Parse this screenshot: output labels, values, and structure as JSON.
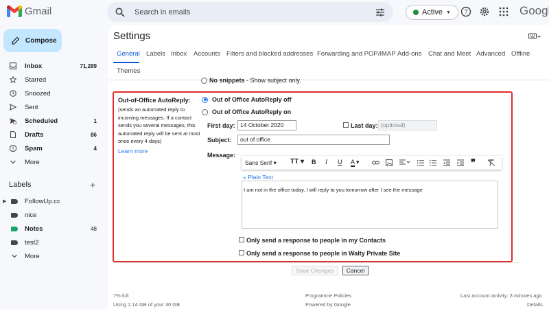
{
  "app": {
    "name": "Gmail"
  },
  "search": {
    "placeholder": "Search in emails"
  },
  "status": {
    "label": "Active",
    "color": "#1e8e3e"
  },
  "brand": {
    "partial": "Googl"
  },
  "compose": {
    "label": "Compose"
  },
  "nav": [
    {
      "label": "Inbox",
      "count": "71,289",
      "icon": "inbox-icon",
      "bold": true
    },
    {
      "label": "Starred",
      "count": "",
      "icon": "star-icon",
      "bold": false
    },
    {
      "label": "Snoozed",
      "count": "",
      "icon": "clock-icon",
      "bold": false
    },
    {
      "label": "Sent",
      "count": "",
      "icon": "send-icon",
      "bold": false
    },
    {
      "label": "Scheduled",
      "count": "1",
      "icon": "scheduled-icon",
      "bold": true
    },
    {
      "label": "Drafts",
      "count": "86",
      "icon": "draft-icon",
      "bold": true
    },
    {
      "label": "Spam",
      "count": "4",
      "icon": "spam-icon",
      "bold": true
    },
    {
      "label": "More",
      "count": "",
      "icon": "chevron-down-icon",
      "bold": false
    }
  ],
  "labels_section": {
    "title": "Labels"
  },
  "labels": [
    {
      "name": "FollowUp.cc",
      "count": "",
      "color": "#444746",
      "bold": false,
      "caret": true
    },
    {
      "name": "nice",
      "count": "",
      "color": "#444746",
      "bold": false,
      "caret": false
    },
    {
      "name": "Notes",
      "count": "48",
      "color": "#16a765",
      "bold": true,
      "caret": false
    },
    {
      "name": "test2",
      "count": "",
      "color": "#444746",
      "bold": false,
      "caret": false
    },
    {
      "name": "More",
      "count": "",
      "color": "",
      "bold": false,
      "caret": false
    }
  ],
  "settings": {
    "title": "Settings",
    "tabs": [
      "General",
      "Labels",
      "Inbox",
      "Accounts",
      "Filters and blocked addresses",
      "Forwarding and POP/IMAP",
      "Add-ons",
      "Chat and Meet",
      "Advanced",
      "Offline",
      "Themes"
    ],
    "active_tab": "General",
    "snippet_label": "No snippets",
    "snippet_desc": " - Show subject only."
  },
  "ooo": {
    "title": "Out-of-Office AutoReply:",
    "desc": "(sends an automated reply to incoming messages. If a contact sends you several messages, this automated reply will be sent at most once every 4 days)",
    "learn_more": "Learn more",
    "off_label": "Out of Office AutoReply off",
    "on_label": "Out of Office AutoReply on",
    "selected": "off",
    "first_day_label": "First day:",
    "first_day_value": "14 October 2020",
    "last_day_label": "Last day:",
    "last_day_placeholder": "(optional)",
    "last_day_checked": false,
    "subject_label": "Subject:",
    "subject_value": "out of office",
    "message_label": "Message:",
    "font_name": "Sans Serif",
    "plain_text_link": "« Plain Text",
    "message_body": "I am not in the office today, I will reply to you tomorrow after I see the message",
    "contacts_only_label": "Only send a response to people in my Contacts",
    "contacts_only_checked": false,
    "org_only_label": "Only send a response to people in Walty Private Site",
    "org_only_checked": false
  },
  "actions": {
    "save": "Save Changes",
    "cancel": "Cancel"
  },
  "footer": {
    "storage_percent": "7% full",
    "storage_detail": "Using 2.14 GB of your 30 GB",
    "policies": "Programme Policies",
    "powered": "Powered by Google",
    "activity": "Last account activity: 3 minutes ago",
    "details": "Details"
  }
}
